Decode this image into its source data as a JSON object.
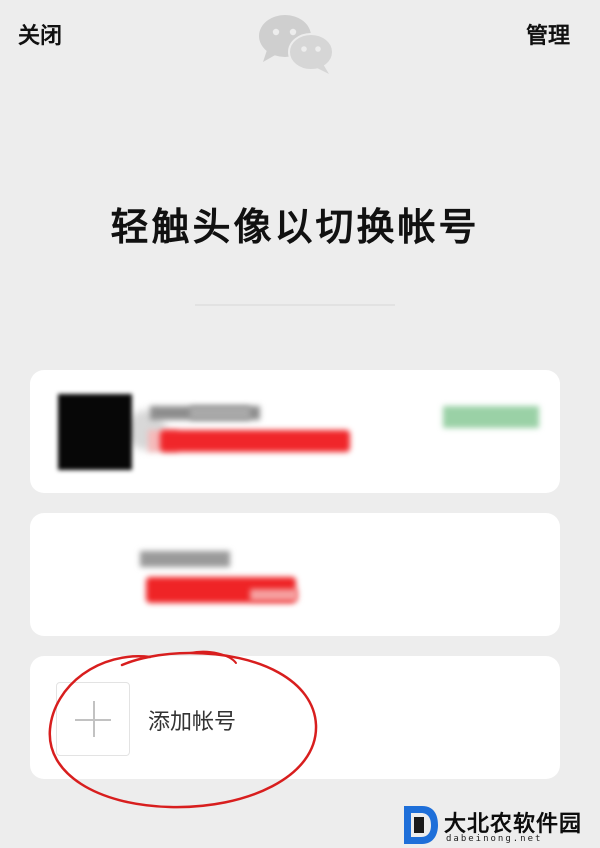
{
  "topbar": {
    "close_label": "关闭",
    "manage_label": "管理",
    "logo_icon": "wechat-logo-icon"
  },
  "headline": "轻触头像以切换帐号",
  "accounts": [
    {
      "name": "",
      "id": "",
      "status": "",
      "redacted": true
    },
    {
      "name": "",
      "id": "",
      "redacted": true
    }
  ],
  "add_account": {
    "label": "添加帐号",
    "icon": "plus-icon"
  },
  "watermark": {
    "text": "大北农软件园",
    "url": "dabeinong.net"
  },
  "colors": {
    "background": "#ededed",
    "card": "#ffffff",
    "redaction_red": "#f0262a",
    "redaction_green": "#9ad1a6",
    "annotation_red": "#d81e1e",
    "watermark_blue": "#1e6fd9"
  }
}
